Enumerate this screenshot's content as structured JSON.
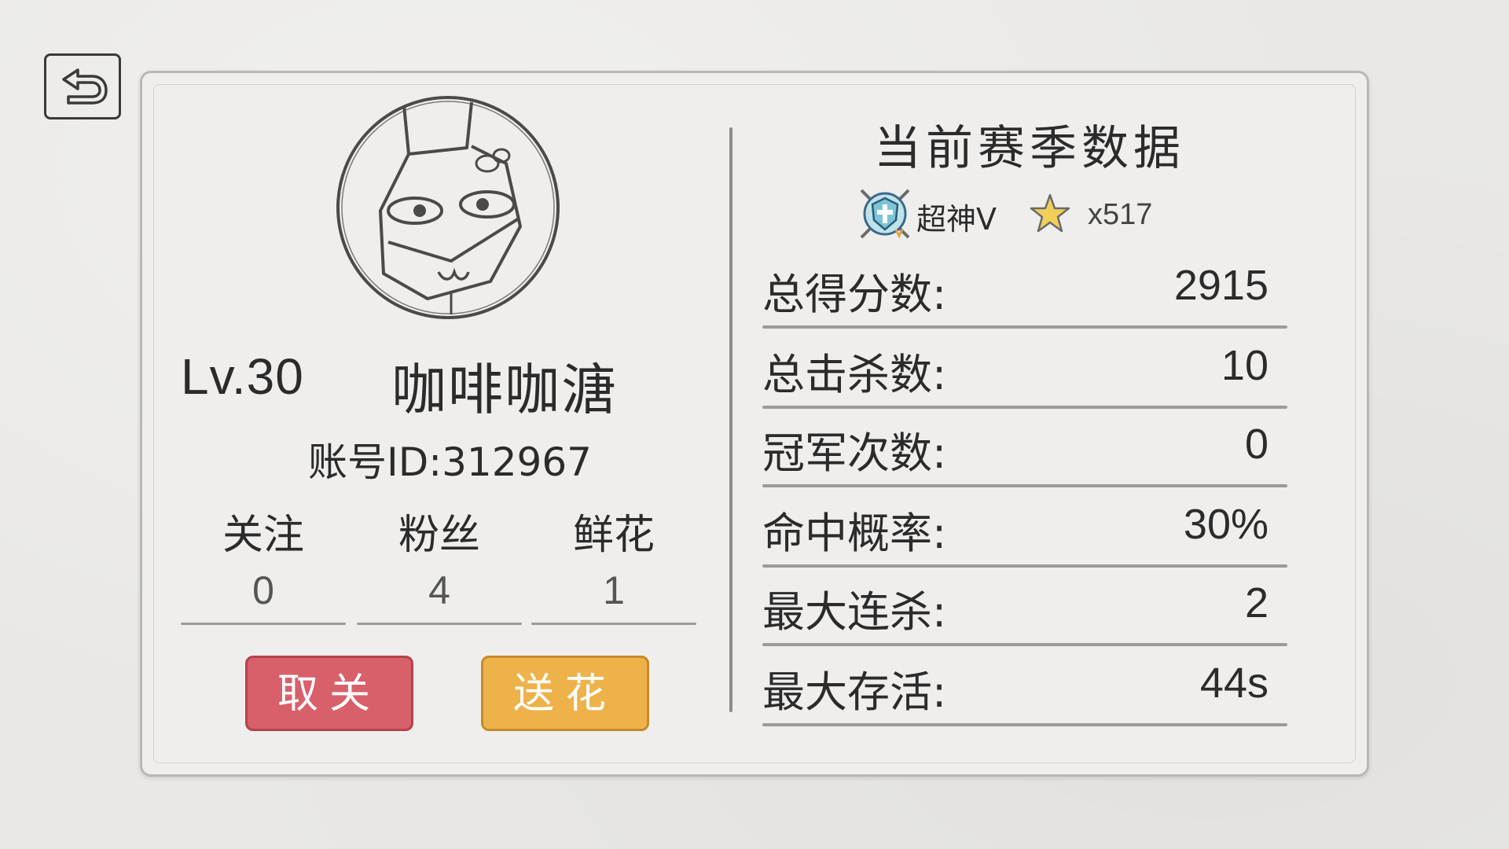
{
  "nav": {
    "back_icon": "back-arrow-icon"
  },
  "profile": {
    "avatar_icon": "cat-avatar-icon",
    "level": "Lv.30",
    "name": "咖啡咖溏",
    "account_id": "账号ID:312967",
    "social": [
      {
        "label": "关注",
        "value": "0"
      },
      {
        "label": "粉丝",
        "value": "4"
      },
      {
        "label": "鲜花",
        "value": "1"
      }
    ],
    "buttons": {
      "unfollow": "取关",
      "send_flower": "送花"
    },
    "colors": {
      "unfollow": "#d8606a",
      "send_flower": "#eeb24a"
    }
  },
  "season": {
    "title": "当前赛季数据",
    "rank_icon": "rank-shield-icon",
    "rank_name": "超神V",
    "star_icon": "star-icon",
    "stars": "x517",
    "stats": [
      {
        "label": "总得分数:",
        "value": "2915"
      },
      {
        "label": "总击杀数:",
        "value": "10"
      },
      {
        "label": "冠军次数:",
        "value": "0"
      },
      {
        "label": "命中概率:",
        "value": "30%"
      },
      {
        "label": "最大连杀:",
        "value": "2"
      },
      {
        "label": "最大存活:",
        "value": "44s"
      }
    ]
  }
}
